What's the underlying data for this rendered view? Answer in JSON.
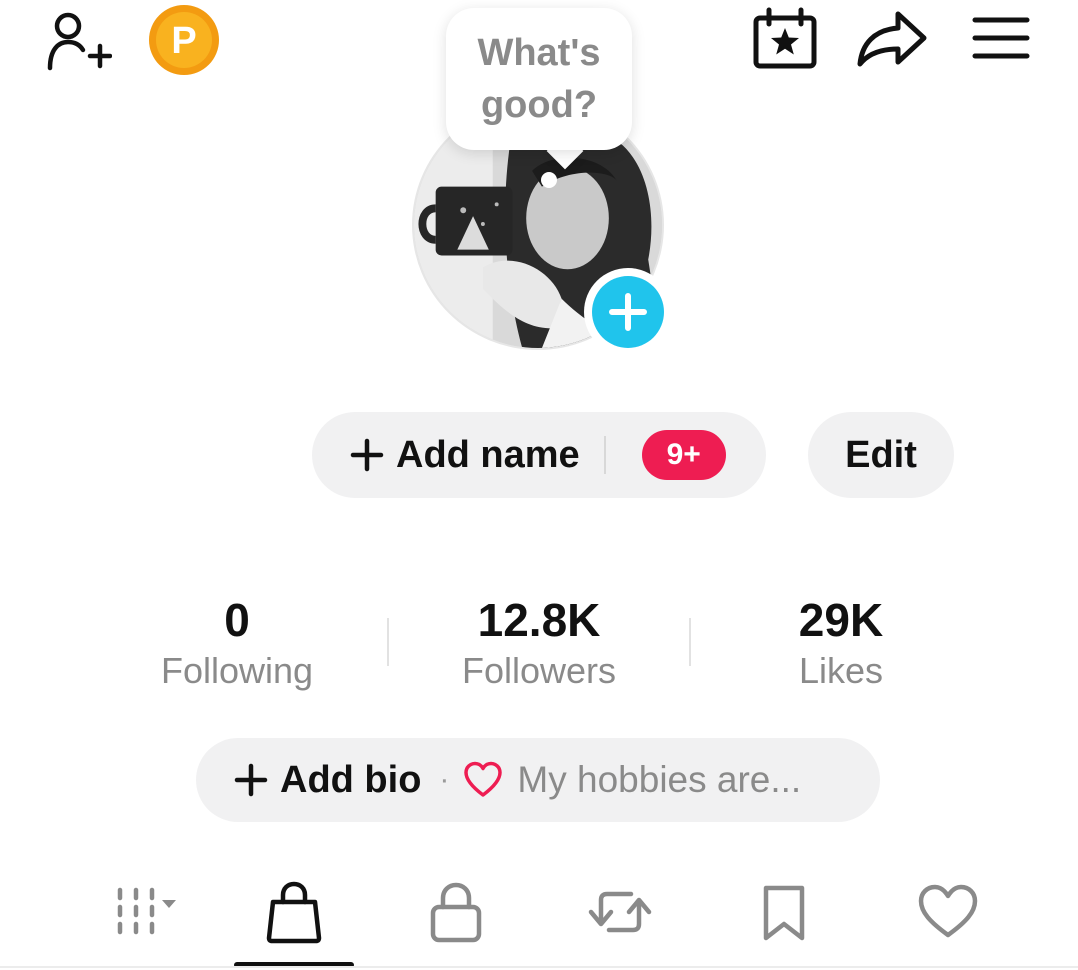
{
  "bubble": {
    "text": "What's\ngood?"
  },
  "profile": {
    "add_name_label": "Add name",
    "notification_badge": "9+",
    "edit_label": "Edit",
    "points_badge_letter": "P"
  },
  "stats": [
    {
      "value": "0",
      "label": "Following"
    },
    {
      "value": "12.8K",
      "label": "Followers"
    },
    {
      "value": "29K",
      "label": "Likes"
    }
  ],
  "bio": {
    "add_label": "Add bio",
    "separator": "·",
    "hint": "My hobbies are..."
  },
  "tabs": [
    {
      "name": "grid-filter-icon",
      "active": false
    },
    {
      "name": "shopping-bag-icon",
      "active": true
    },
    {
      "name": "lock-icon",
      "active": false
    },
    {
      "name": "repost-icon",
      "active": false
    },
    {
      "name": "bookmark-icon",
      "active": false
    },
    {
      "name": "heart-icon",
      "active": false
    }
  ],
  "colors": {
    "accent_pink": "#ee1d52",
    "accent_cyan": "#20c4ec",
    "points_orange": "#f7a51c",
    "pill_background": "#f1f1f2",
    "muted_text": "#8a8a8a"
  }
}
